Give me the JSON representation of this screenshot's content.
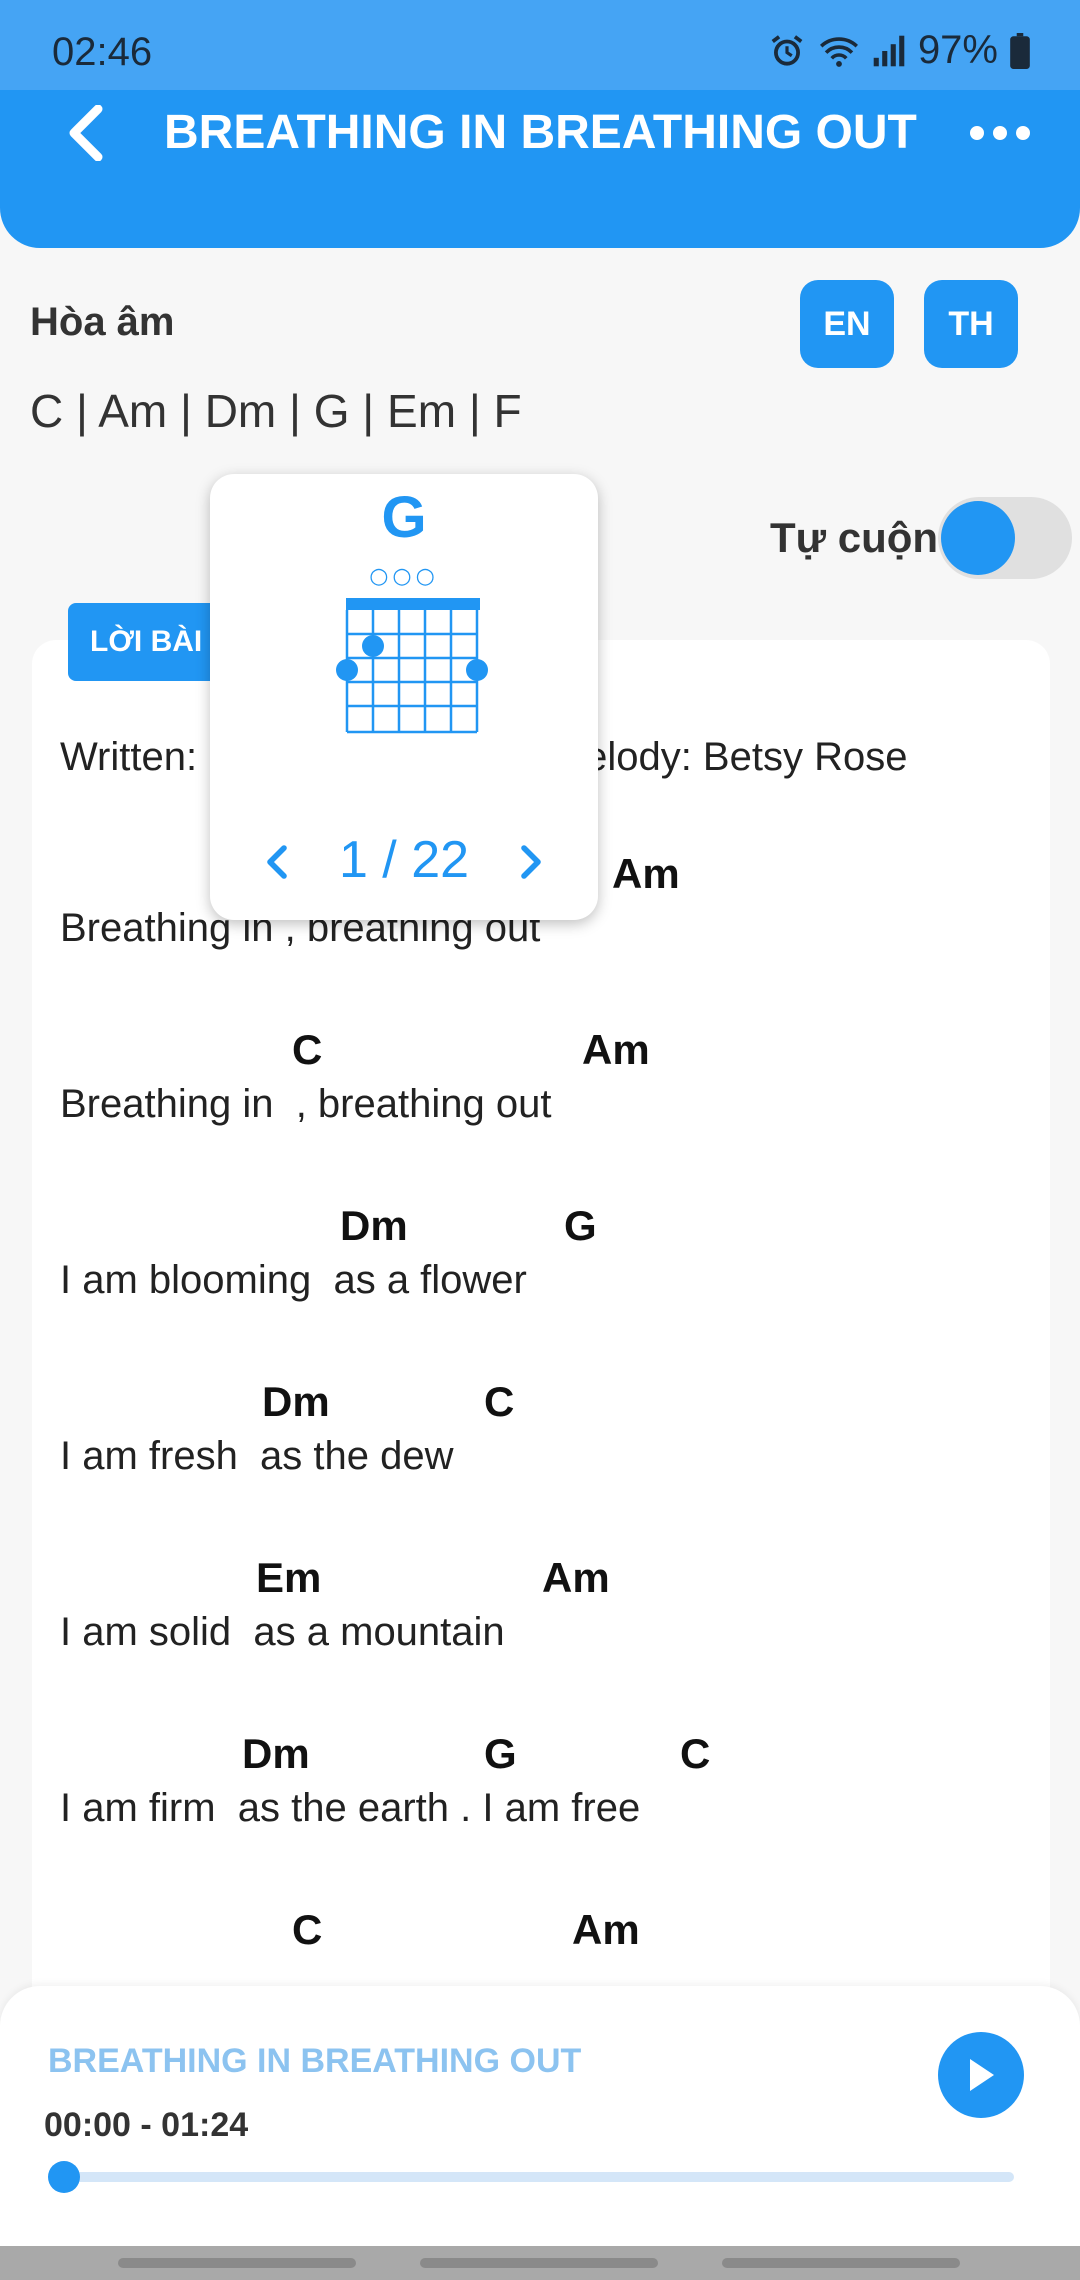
{
  "status_bar": {
    "time": "02:46",
    "battery": "97%",
    "icons": [
      "alarm-icon",
      "wifi-icon",
      "signal-icon",
      "battery-icon"
    ]
  },
  "header": {
    "title": "BREATHING IN BREATHING OUT",
    "back_icon": "chevron-left-icon",
    "more_icon": "more-horizontal-icon"
  },
  "harmony": {
    "label": "Hòa âm",
    "chords": "C | Am | Dm | G | Em | F",
    "lang_buttons": [
      "EN",
      "TH"
    ]
  },
  "auto_scroll": {
    "label": "Tự cuộn",
    "on": false
  },
  "lyrics_tab": {
    "label": "LỜI BÀI HÁT"
  },
  "chord_popup": {
    "chord": "G",
    "page": "1 / 22",
    "open_strings": "○○○"
  },
  "lyrics": {
    "written_left": "Written:",
    "written_right": "elody: Betsy Rose",
    "lines": [
      {
        "chords": [
          "Am"
        ],
        "text": "Breathing in , breathing out"
      },
      {
        "chords": [
          "C",
          "Am"
        ],
        "text": "Breathing in  , breathing out"
      },
      {
        "chords": [
          "Dm",
          "G"
        ],
        "text": "I am blooming  as a flower"
      },
      {
        "chords": [
          "Dm",
          "C"
        ],
        "text": "I am fresh  as the dew"
      },
      {
        "chords": [
          "Em",
          "Am"
        ],
        "text": "I am solid  as a mountain"
      },
      {
        "chords": [
          "Dm",
          "G",
          "C"
        ],
        "text": "I am firm  as the earth . I am free"
      },
      {
        "chords": [
          "C",
          "Am"
        ],
        "text": ""
      }
    ]
  },
  "player": {
    "title": "BREATHING IN BREATHING OUT",
    "time": "00:00 - 01:24",
    "progress": 0,
    "play_icon": "play-icon"
  },
  "colors": {
    "primary": "#2196f3",
    "status_bar": "#45a4f4",
    "player_title": "#8cc3f0"
  }
}
